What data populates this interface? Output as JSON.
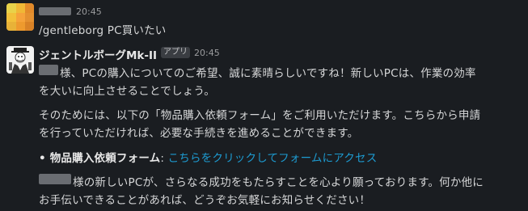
{
  "message1": {
    "time": "20:45",
    "text": "/gentleborg PC買いたい"
  },
  "message2": {
    "bot_name": "ジェントルボーグMk-II",
    "app_badge": "アプリ",
    "time": "20:45",
    "p1_line1": "様、PCの購入についてのご希望、誠に素晴らしいですね！新しいPCは、作業の効率",
    "p1_line2": "を大いに向上させることでしょう。",
    "p2_line1": "そのためには、以下の「物品購入依頼フォーム」をご利用いただけます。こちらから申請",
    "p2_line2": "を行っていただければ、必要な手続きを進めることができます。",
    "bullet_label": "• 物品購入依頼フォーム",
    "bullet_colon": ": ",
    "bullet_link": "こちらをクリックしてフォームにアクセス",
    "p3_line1": "様の新しいPCが、さらなる成功をもたらすことを心より願っております。何か他に",
    "p3_line2": "お手伝いできることがあれば、どうぞお気軽にお知らせください！"
  },
  "colors": {
    "background": "#1a1d21",
    "link": "#1d9bd1",
    "avatar_user": "#f0a030"
  },
  "icons": {
    "user_avatar": "pixelated-avatar-icon",
    "bot_avatar": "gentleman-robot-avatar-icon"
  }
}
